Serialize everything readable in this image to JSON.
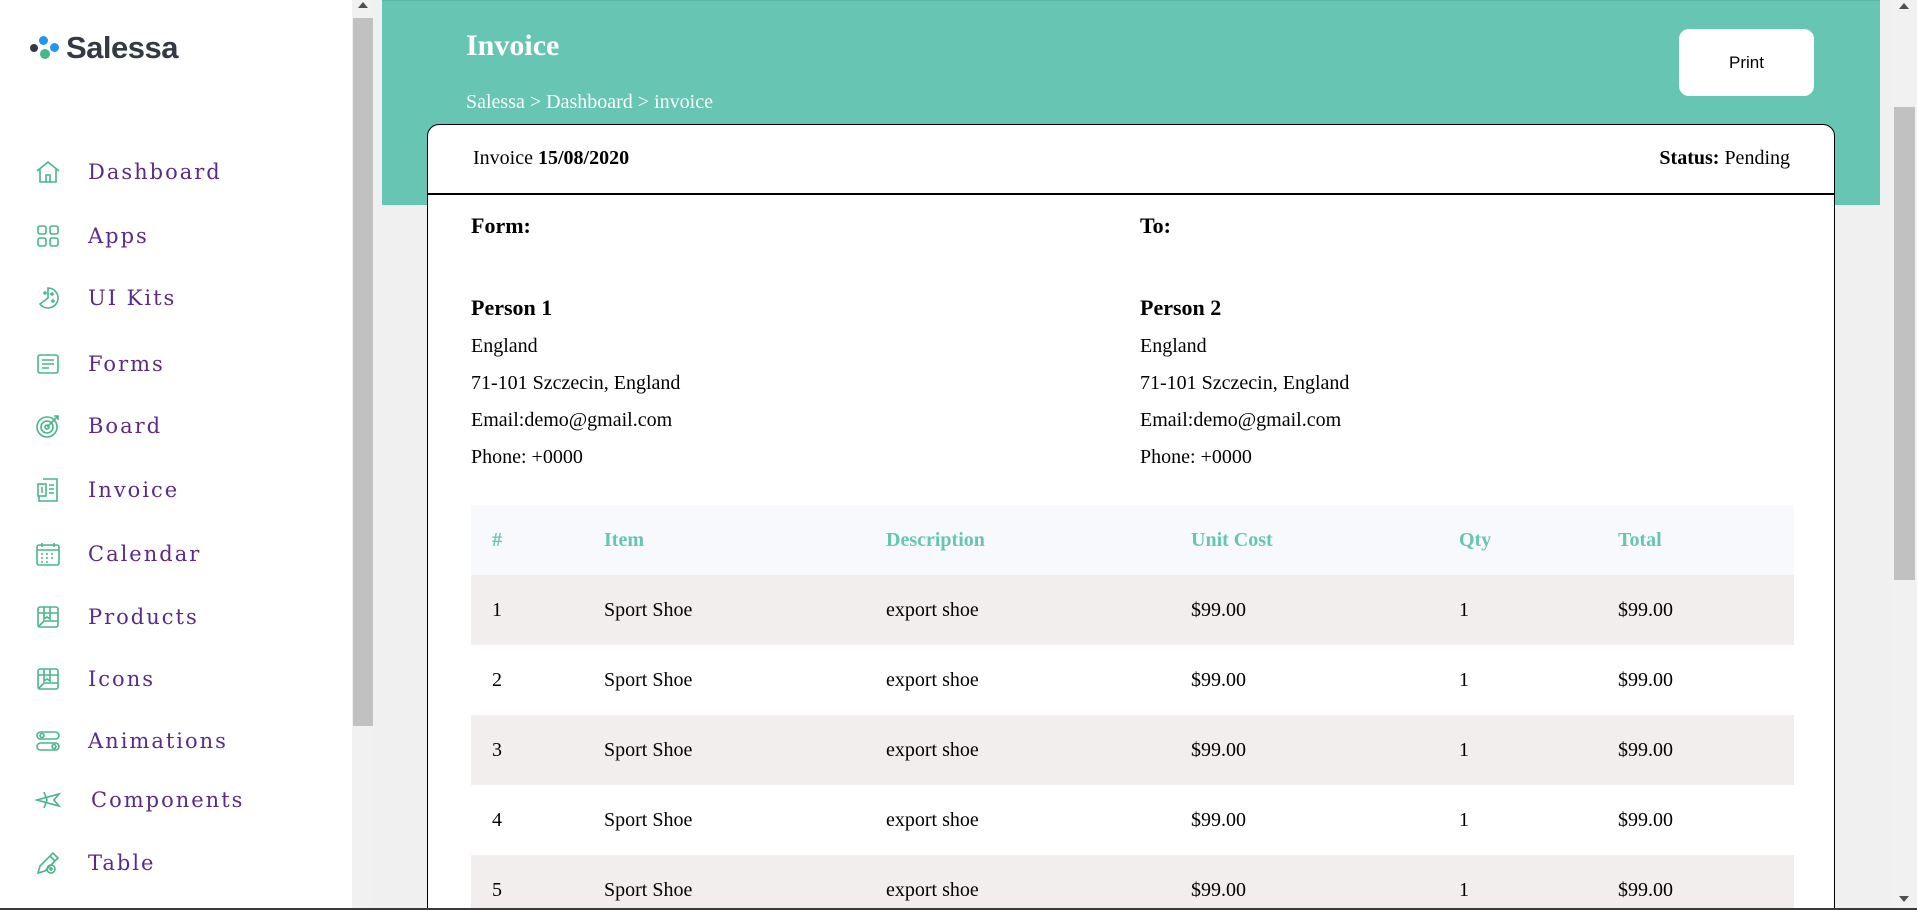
{
  "brand": {
    "name": "Salessa",
    "colors": {
      "primary": "#67c6b3",
      "nav_text": "#5b2a86",
      "logo_dark": "#333a45",
      "logo_blue": "#2196f3",
      "logo_green": "#48b58a"
    }
  },
  "sidebar": {
    "items": [
      {
        "label": "Dashboard",
        "icon": "home-icon"
      },
      {
        "label": "Apps",
        "icon": "grid-icon"
      },
      {
        "label": "UI Kits",
        "icon": "palette-icon"
      },
      {
        "label": "Forms",
        "icon": "form-icon"
      },
      {
        "label": "Board",
        "icon": "target-icon"
      },
      {
        "label": "Invoice",
        "icon": "invoice-icon"
      },
      {
        "label": "Calendar",
        "icon": "calendar-icon"
      },
      {
        "label": "Products",
        "icon": "box-icon"
      },
      {
        "label": "Icons",
        "icon": "box-icon"
      },
      {
        "label": "Animations",
        "icon": "sliders-icon"
      },
      {
        "label": "Components",
        "icon": "plane-icon"
      },
      {
        "label": "Table",
        "icon": "pen-icon"
      }
    ]
  },
  "header": {
    "title": "Invoice",
    "breadcrumb": "Salessa > Dashboard > invoice",
    "print_label": "Print"
  },
  "invoice": {
    "date_label": "Invoice",
    "date": "15/08/2020",
    "status_label": "Status:",
    "status": "Pending",
    "from": {
      "label": "Form:",
      "name": "Person 1",
      "country": "England",
      "address": "71-101 Szczecin, England",
      "email": "Email:demo@gmail.com",
      "phone": "Phone: +0000"
    },
    "to": {
      "label": "To:",
      "name": "Person 2",
      "country": "England",
      "address": "71-101 Szczecin, England",
      "email": "Email:demo@gmail.com",
      "phone": "Phone: +0000"
    },
    "table": {
      "headers": [
        "#",
        "Item",
        "Description",
        "Unit Cost",
        "Qty",
        "Total"
      ],
      "rows": [
        [
          "1",
          "Sport Shoe",
          "export shoe",
          "$99.00",
          "1",
          "$99.00"
        ],
        [
          "2",
          "Sport Shoe",
          "export shoe",
          "$99.00",
          "1",
          "$99.00"
        ],
        [
          "3",
          "Sport Shoe",
          "export shoe",
          "$99.00",
          "1",
          "$99.00"
        ],
        [
          "4",
          "Sport Shoe",
          "export shoe",
          "$99.00",
          "1",
          "$99.00"
        ],
        [
          "5",
          "Sport Shoe",
          "export shoe",
          "$99.00",
          "1",
          "$99.00"
        ]
      ]
    }
  }
}
